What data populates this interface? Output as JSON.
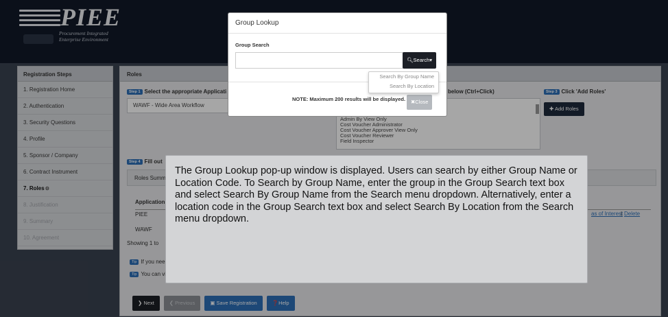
{
  "header": {
    "logo_text": "PIEE",
    "logo_subtitle_1": "Procurement Integrated",
    "logo_subtitle_2": "Enterprise Environment"
  },
  "sidebar": {
    "title": "Registration Steps",
    "items": [
      {
        "label": "1. Registration Home"
      },
      {
        "label": "2. Authentication"
      },
      {
        "label": "3. Security Questions"
      },
      {
        "label": "4. Profile"
      },
      {
        "label": "5. Sponsor / Company"
      },
      {
        "label": "6. Contract Instrument"
      },
      {
        "label": "7. Roles"
      },
      {
        "label": "8. Justification"
      },
      {
        "label": "9. Summary"
      },
      {
        "label": "10. Agreement"
      }
    ]
  },
  "main": {
    "title": "Roles",
    "step1_tag": "Step 1",
    "step1_label": "Select the appropriate Applicati",
    "app_selected": "WAWF - Wide Area Workflow",
    "step2_label": "below (Ctrl+Click)",
    "roles_list": [
      "Admin By View Only",
      "Cost Voucher Administrator",
      "Cost Voucher Approver View Only",
      "Cost Voucher Reviewer",
      "Field Inspector"
    ],
    "step3_tag": "Step 3",
    "step3_label": "Click 'Add Roles'",
    "add_roles_button": "Add Roles",
    "step4_tag": "Step 4",
    "step4_label": "Fill out",
    "roles_summary": "Roles Summa",
    "table_header": "Application",
    "rows": [
      "PIEE",
      "WAWF"
    ],
    "links": {
      "interest": "as of Interest",
      "separator": "|",
      "delete": "Delete"
    },
    "showing": "Showing 1 to",
    "tip_tag": "Tip",
    "tip1": "If you nee",
    "tip2": "You can vi"
  },
  "nav_buttons": {
    "next": "Next",
    "previous": "Previous",
    "save": "Save Registration",
    "help": "Help"
  },
  "modal": {
    "title": "Group Lookup",
    "field_label": "Group Search",
    "input_value": "",
    "search_button": "Search",
    "note": "NOTE: Maximum 200 results will be displayed.",
    "close_button": "Close",
    "dropdown": [
      "Search By Group Name",
      "Search By Location"
    ]
  },
  "callout": {
    "text": "The Group Lookup pop-up window is displayed. Users can search by either Group Name or Location Code. To Search by Group Name, enter the group in the Group Search text box and select Search By Group Name from the Search menu dropdown. Alternatively, enter a location code in the Group Search text box and select Search By Location from the Search menu dropdown."
  },
  "colors": {
    "brand_blue": "#2d6fb7",
    "dark": "#1c1f26",
    "header_bg": "#111a28",
    "close_gray": "#b5b9be"
  }
}
